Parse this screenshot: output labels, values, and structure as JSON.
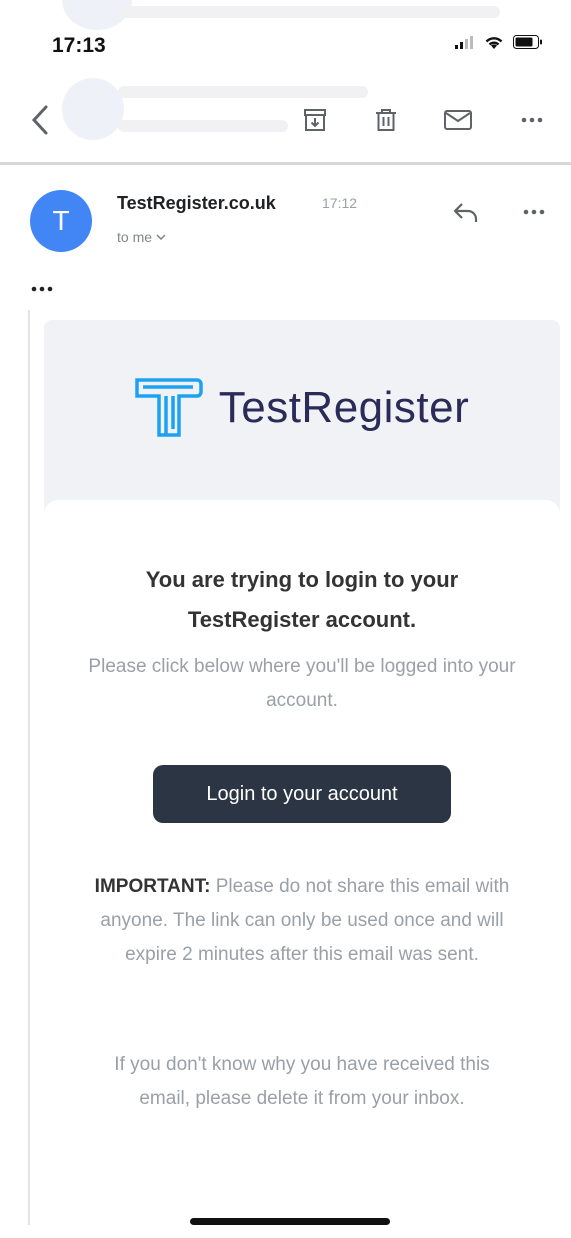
{
  "status_bar": {
    "time": "17:13"
  },
  "toolbar": {
    "back": "back",
    "archive": "archive",
    "delete": "delete",
    "mark_unread": "mark-unread",
    "more": "more"
  },
  "message": {
    "sender": "TestRegister.co.uk",
    "time": "17:12",
    "to": "to me",
    "avatar_letter": "T"
  },
  "email": {
    "brand": "TestRegister",
    "title_line1": "You are trying to login to your",
    "title_line2": "TestRegister account.",
    "subtitle": "Please click below where you'll be logged into your account.",
    "button_label": "Login to your account",
    "important_label": "IMPORTANT:",
    "important_text": " Please do not share this email with anyone. The link can only be used once and will expire 2 minutes after this email was sent.",
    "notice": "If you don't know why you have received this email, please delete it from your inbox."
  },
  "colors": {
    "brand_blue": "#1da1f2",
    "button": "#2c3544",
    "avatar": "#4285f4"
  }
}
